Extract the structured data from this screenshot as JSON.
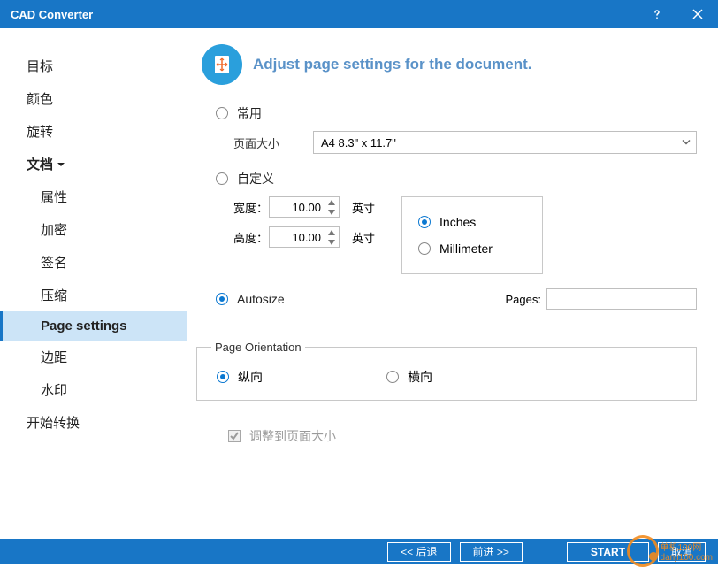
{
  "title": "CAD Converter",
  "sidebar": {
    "items": [
      {
        "label": "目标"
      },
      {
        "label": "颜色"
      },
      {
        "label": "旋转"
      },
      {
        "label": "文档",
        "expanded": true
      },
      {
        "label": "属性",
        "sub": true
      },
      {
        "label": "加密",
        "sub": true
      },
      {
        "label": "签名",
        "sub": true
      },
      {
        "label": "压缩",
        "sub": true
      },
      {
        "label": "Page settings",
        "sub": true,
        "selected": true
      },
      {
        "label": "边距",
        "sub": true
      },
      {
        "label": "水印",
        "sub": true
      },
      {
        "label": "开始转换"
      }
    ]
  },
  "header_title": "Adjust page settings for the document.",
  "mode": {
    "common_label": "常用",
    "custom_label": "自定义",
    "autosize_label": "Autosize",
    "selected": "autosize"
  },
  "page_size": {
    "label": "页面大小",
    "value": "A4 8.3\" x 11.7\""
  },
  "dimensions": {
    "width_label": "宽度：",
    "width_value": "10.00",
    "height_label": "高度：",
    "height_value": "10.00",
    "unit_text": "英寸"
  },
  "units": {
    "inches_label": "Inches",
    "millimeter_label": "Millimeter",
    "selected": "inches"
  },
  "pages": {
    "label": "Pages:",
    "value": ""
  },
  "orientation": {
    "legend": "Page Orientation",
    "portrait_label": "纵向",
    "landscape_label": "横向",
    "selected": "portrait"
  },
  "fit_to_page": {
    "label": "调整到页面大小",
    "checked": true,
    "disabled": true
  },
  "footer": {
    "back": "<< 后退",
    "forward": "前进 >>",
    "start": "START",
    "cancel": "取消"
  },
  "watermark": {
    "text1": "单机100网",
    "text2": "danji100.com"
  }
}
